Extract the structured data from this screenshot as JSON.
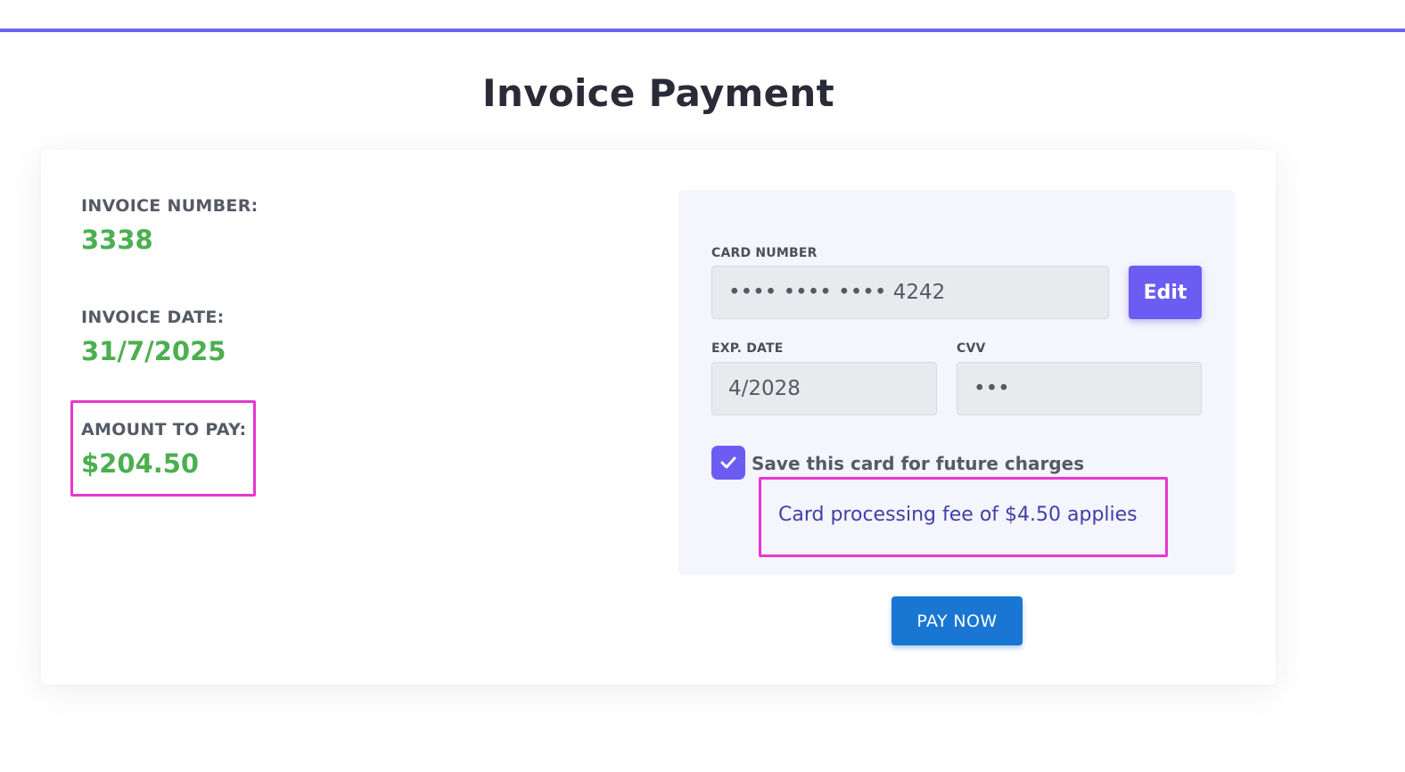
{
  "page": {
    "title": "Invoice Payment"
  },
  "invoice": {
    "number_label": "INVOICE NUMBER:",
    "number_value": "3338",
    "date_label": "INVOICE DATE:",
    "date_value": "31/7/2025",
    "amount_label": "AMOUNT TO PAY:",
    "amount_value": "$204.50"
  },
  "payment": {
    "card_number_label": "CARD NUMBER",
    "card_number_value": "•••• •••• •••• 4242",
    "edit_label": "Edit",
    "exp_label": "EXP. DATE",
    "exp_value": "4/2028",
    "cvv_label": "CVV",
    "cvv_value": "•••",
    "save_card_label": "Save this card for future charges",
    "save_card_checked": true,
    "fee_text": "Card processing fee of $4.50 applies",
    "pay_label": "PAY NOW"
  },
  "colors": {
    "accent": "#6b5cf2",
    "value_green": "#4caf50",
    "pay_button": "#1976d2",
    "highlight": "#e936cf",
    "fee_text": "#3f3fa8"
  },
  "icons": {
    "checkbox": "checkmark-icon"
  }
}
